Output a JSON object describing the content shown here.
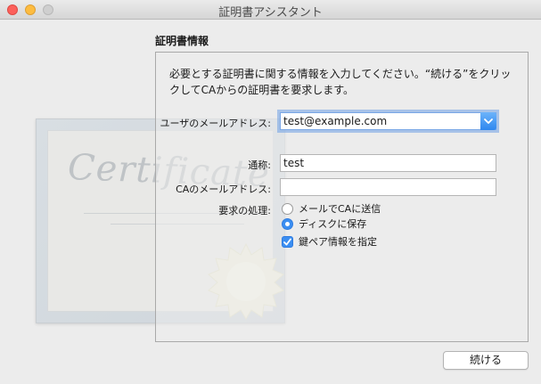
{
  "window": {
    "title": "証明書アシスタント"
  },
  "section": {
    "title": "証明書情報"
  },
  "intro_text": "必要とする証明書に関する情報を入力してください。“続ける”をクリックしてCAからの証明書を要求します。",
  "artwork": {
    "script_text": "Certificate"
  },
  "form": {
    "user_email": {
      "label": "ユーザのメールアドレス:",
      "value": "test@example.com"
    },
    "common_name": {
      "label": "通称:",
      "value": "test"
    },
    "ca_email": {
      "label": "CAのメールアドレス:",
      "value": ""
    },
    "request": {
      "label": "要求の処理:",
      "options": [
        {
          "label": "メールでCAに送信",
          "selected": false
        },
        {
          "label": "ディスクに保存",
          "selected": true
        }
      ],
      "key_pair": {
        "label": "鍵ペア情報を指定",
        "checked": true
      }
    }
  },
  "buttons": {
    "continue": "続ける"
  },
  "colors": {
    "accent": "#3b8ef1",
    "close": "#fc605b",
    "minimize": "#fdbc40"
  }
}
